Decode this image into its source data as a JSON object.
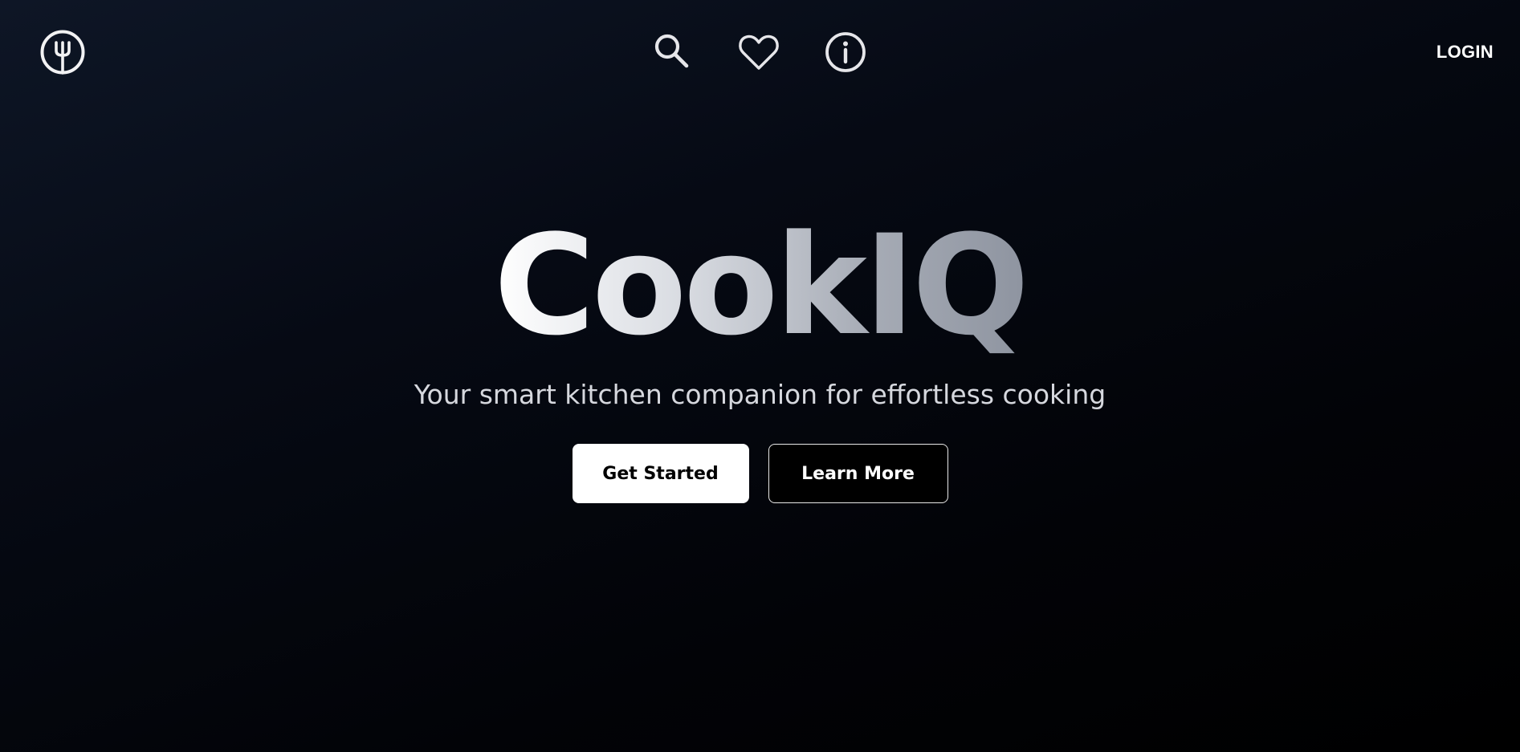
{
  "header": {
    "logo_icon": "fork-circle-icon",
    "nav_icons": [
      "search-icon",
      "heart-icon",
      "info-icon"
    ],
    "login_label": "LOGIN"
  },
  "hero": {
    "title": "CookIQ",
    "tagline": "Your smart kitchen companion for effortless cooking",
    "primary_button": "Get Started",
    "secondary_button": "Learn More"
  },
  "colors": {
    "background_top": "#0e1626",
    "background_bottom": "#000000",
    "icon_stroke": "#e6e6ea",
    "primary_button_bg": "#ffffff",
    "secondary_button_bg": "#000000"
  }
}
